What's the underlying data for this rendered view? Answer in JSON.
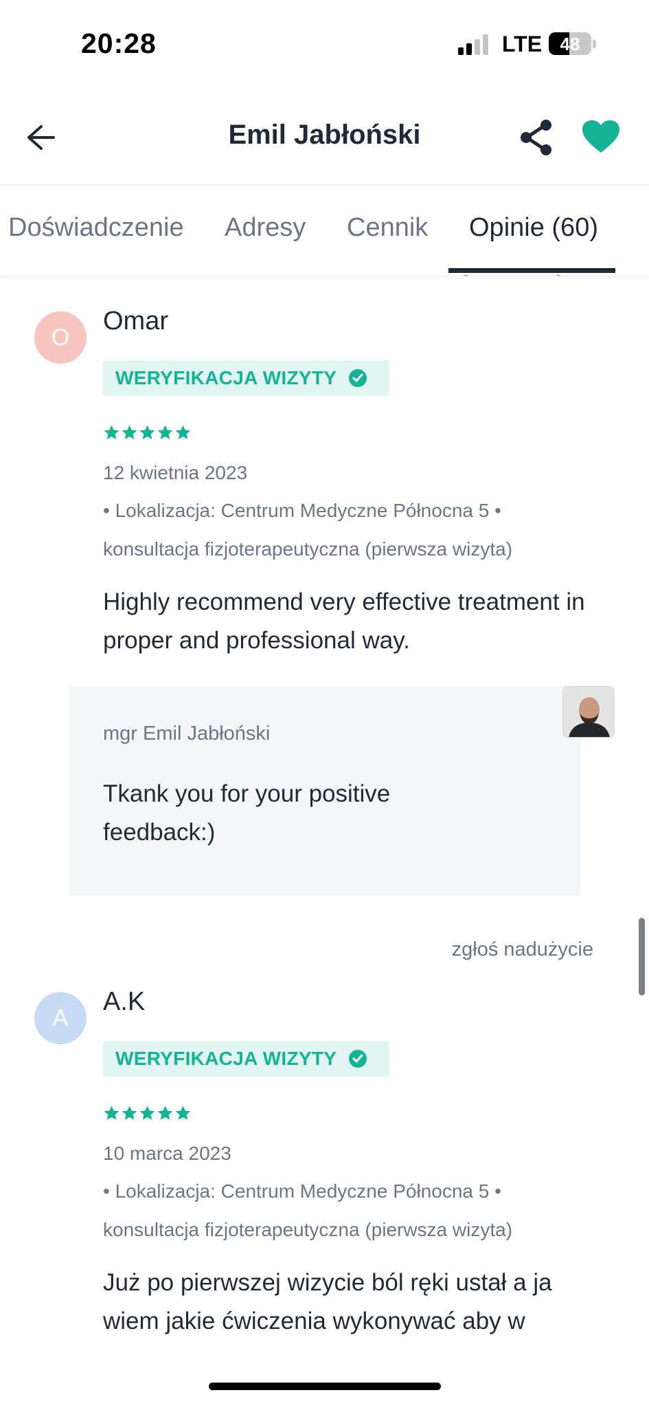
{
  "status_bar": {
    "time": "20:28",
    "network": "LTE",
    "battery_percent": "48",
    "battery_level": 0.48,
    "signal_bars_active": 2,
    "signal_bars_total": 4
  },
  "header": {
    "title": "Emil Jabłoński",
    "back_icon": "arrow-left-icon",
    "share_icon": "share-icon",
    "favorite_icon": "heart-icon",
    "favorite_color": "#14b395"
  },
  "tabs": [
    {
      "label": "Doświadczenie",
      "active": false
    },
    {
      "label": "Adresy",
      "active": false
    },
    {
      "label": "Cennik",
      "active": false
    },
    {
      "label": "Opinie (60)",
      "active": true
    }
  ],
  "report_label": "zgłoś nadużycie",
  "reviews": [
    {
      "initial": "O",
      "author": "Omar",
      "avatar_color": "#f6c5c0",
      "badge": "WERYFIKACJA WIZYTY",
      "rating": 5,
      "date": "12 kwietnia 2023",
      "meta": "• Lokalizacja: Centrum Medyczne Północna 5 • konsultacja fizjoterapeutyczna (pierwsza wizyta)",
      "text": "Highly recommend very effective treatment in proper and professional way.",
      "reply": {
        "author": "mgr Emil Jabłoński",
        "text": "Tkank you for your positive feedback:)"
      }
    },
    {
      "initial": "A",
      "author": "A.K",
      "avatar_color": "#c7dbf4",
      "badge": "WERYFIKACJA WIZYTY",
      "rating": 5,
      "date": "10 marca 2023",
      "meta": "• Lokalizacja: Centrum Medyczne Północna 5 • konsultacja fizjoterapeutyczna (pierwsza wizyta)",
      "text": "Już po pierwszej wizycie ból ręki ustał a ja wiem jakie ćwiczenia wykonywać aby w"
    }
  ],
  "colors": {
    "accent": "#14b395",
    "text": "#1f2a37",
    "muted": "#6b7684"
  }
}
